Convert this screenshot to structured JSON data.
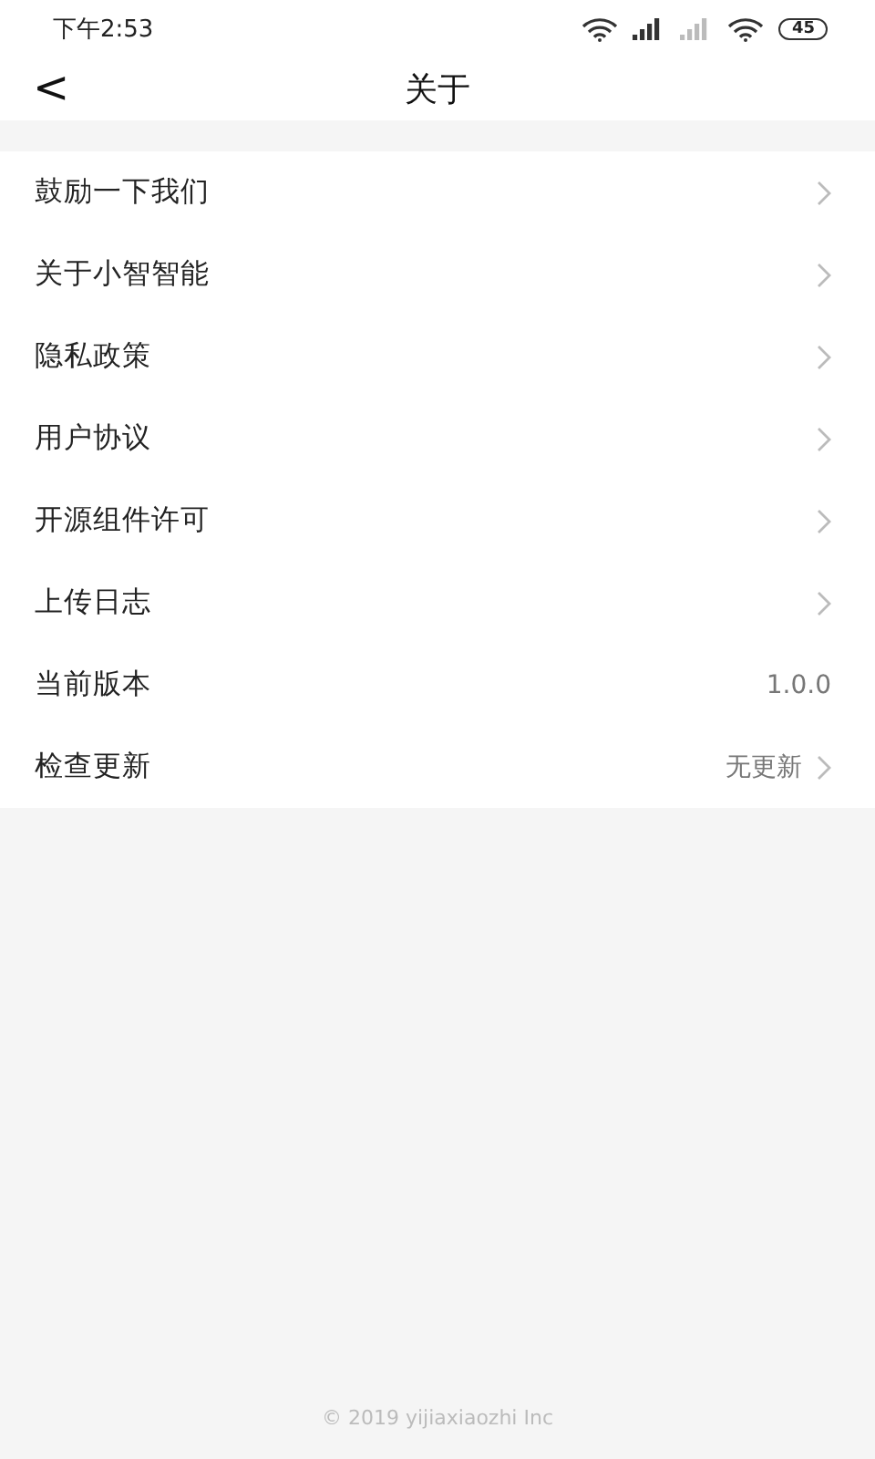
{
  "status_bar": {
    "time": "下午2:53",
    "battery": "45"
  },
  "header": {
    "back": "<",
    "title": "关于"
  },
  "rows": [
    {
      "label": "鼓励一下我们",
      "arrow": true
    },
    {
      "label": "关于小智智能",
      "arrow": true
    },
    {
      "label": "隐私政策",
      "arrow": true
    },
    {
      "label": "用户协议",
      "arrow": true
    },
    {
      "label": "开源组件许可",
      "arrow": true
    },
    {
      "label": "上传日志",
      "arrow": true
    },
    {
      "label": "当前版本",
      "value": "1.0.0",
      "arrow": false
    },
    {
      "label": "检查更新",
      "value": "无更新",
      "arrow": true
    }
  ],
  "footer": "© 2019 yijiaxiaozhi Inc"
}
